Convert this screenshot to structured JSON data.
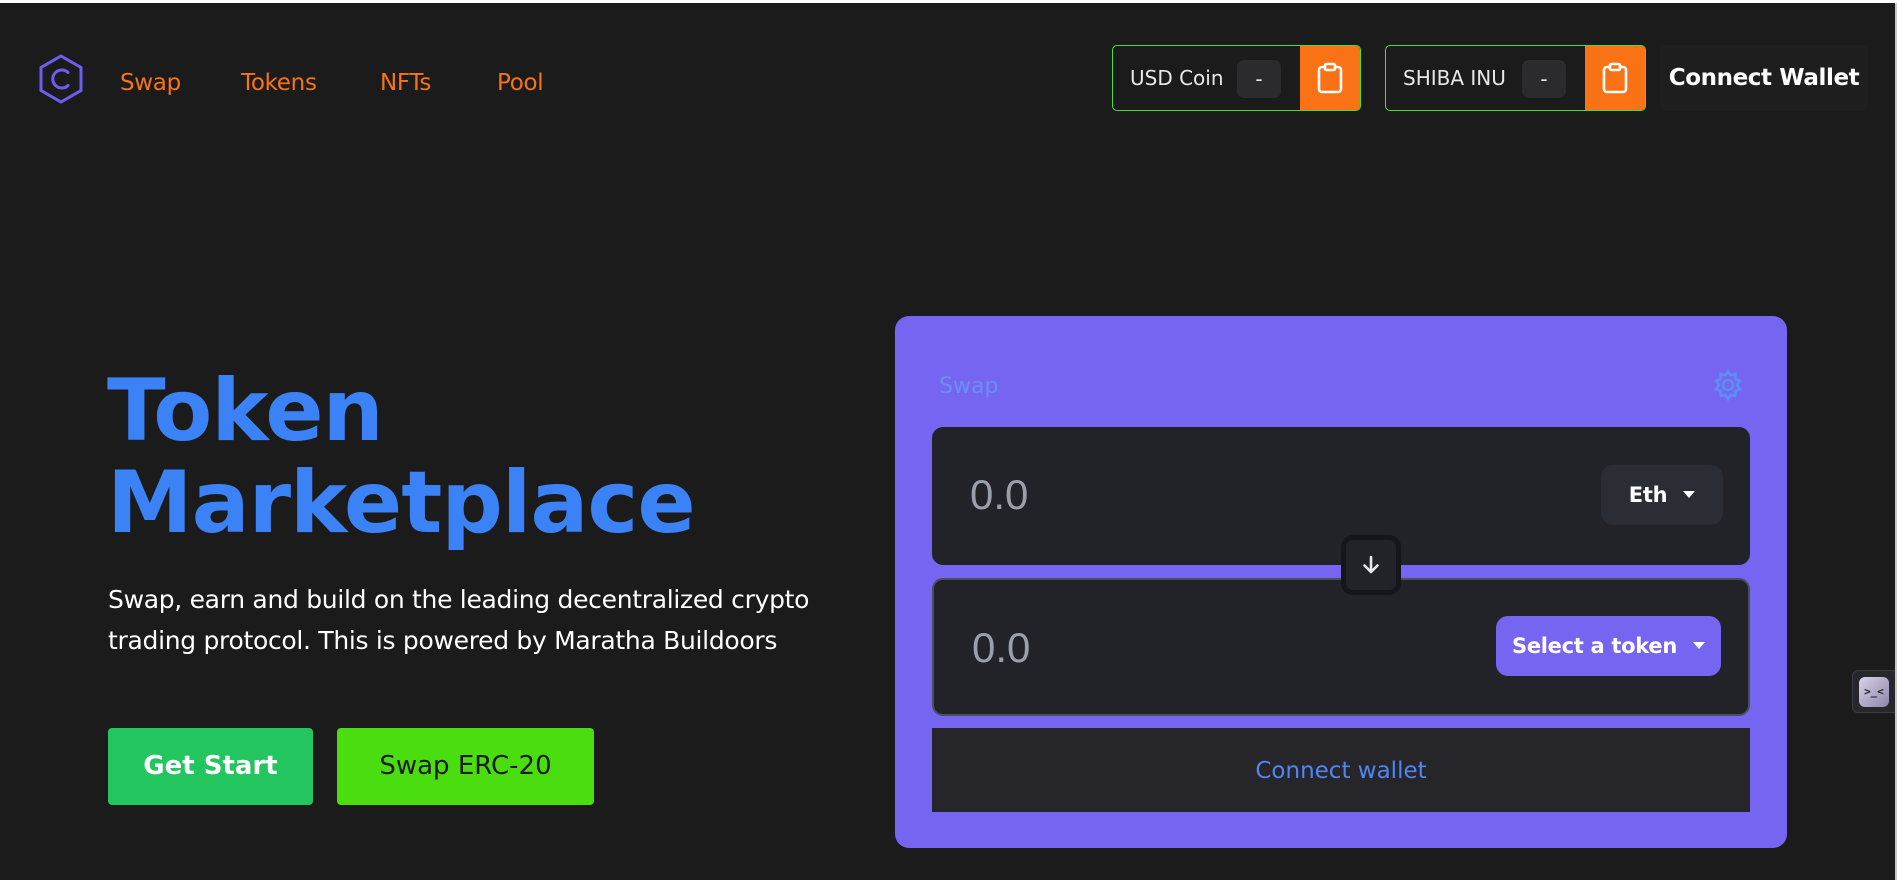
{
  "nav": {
    "logo_icon": "hexagon-c-logo-icon",
    "links": [
      "Swap",
      "Tokens",
      "NFTs",
      "Pool"
    ]
  },
  "header": {
    "tokens": [
      {
        "name": "USD Coin",
        "value": "-",
        "icon": "clipboard-icon"
      },
      {
        "name": "SHIBA INU",
        "value": "-",
        "icon": "clipboard-icon"
      }
    ],
    "connect_label": "Connect Wallet"
  },
  "hero": {
    "title_line1": "Token",
    "title_line2": "Marketplace",
    "subtitle_line1": "Swap, earn and build on the leading decentralized crypto",
    "subtitle_line2": "trading protocol. This is powered by Maratha Buildoors",
    "get_start_label": "Get Start",
    "swap_erc20_label": "Swap ERC-20"
  },
  "swap_card": {
    "title": "Swap",
    "settings_icon": "gear-icon",
    "from_amount_placeholder": "0.0",
    "from_token": "Eth",
    "to_amount_placeholder": "0.0",
    "to_token": "Select a token",
    "switch_icon": "arrow-down-icon",
    "connect_label": "Connect wallet"
  },
  "colors": {
    "background": "#1b1b1c",
    "nav_link": "#f97316",
    "hero_title": "#3b82f6",
    "card": "#7565f0",
    "get_start": "#22c55e",
    "swap_erc20": "#4ade10"
  },
  "side_widget": {
    "icon": "assistant-face-icon",
    "glyph": ">_<"
  }
}
